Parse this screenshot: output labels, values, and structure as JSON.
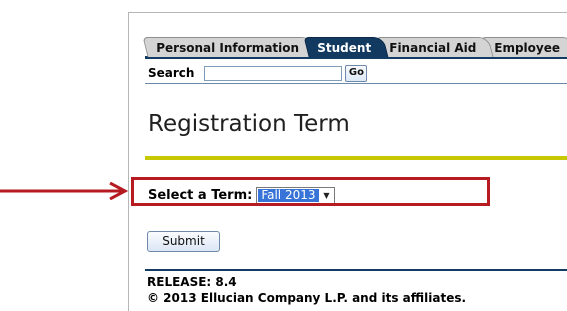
{
  "nav": {
    "tabs": [
      {
        "label": "Personal Information",
        "active": false
      },
      {
        "label": "Student",
        "active": true
      },
      {
        "label": "Financial Aid",
        "active": false
      },
      {
        "label": "Employee",
        "active": false
      }
    ]
  },
  "search": {
    "label": "Search",
    "value": "",
    "go_label": "Go"
  },
  "page": {
    "title": "Registration Term"
  },
  "term": {
    "label": "Select a Term:",
    "selected": "Fall 2013"
  },
  "form": {
    "submit_label": "Submit"
  },
  "footer": {
    "release": "RELEASE: 8.4",
    "copyright": "© 2013 Ellucian Company L.P. and its affiliates."
  },
  "colors": {
    "nav_blue": "#123c63",
    "accent_yellow": "#c8c800",
    "annotation_red": "#b51b20",
    "selection_blue": "#3874d8"
  }
}
